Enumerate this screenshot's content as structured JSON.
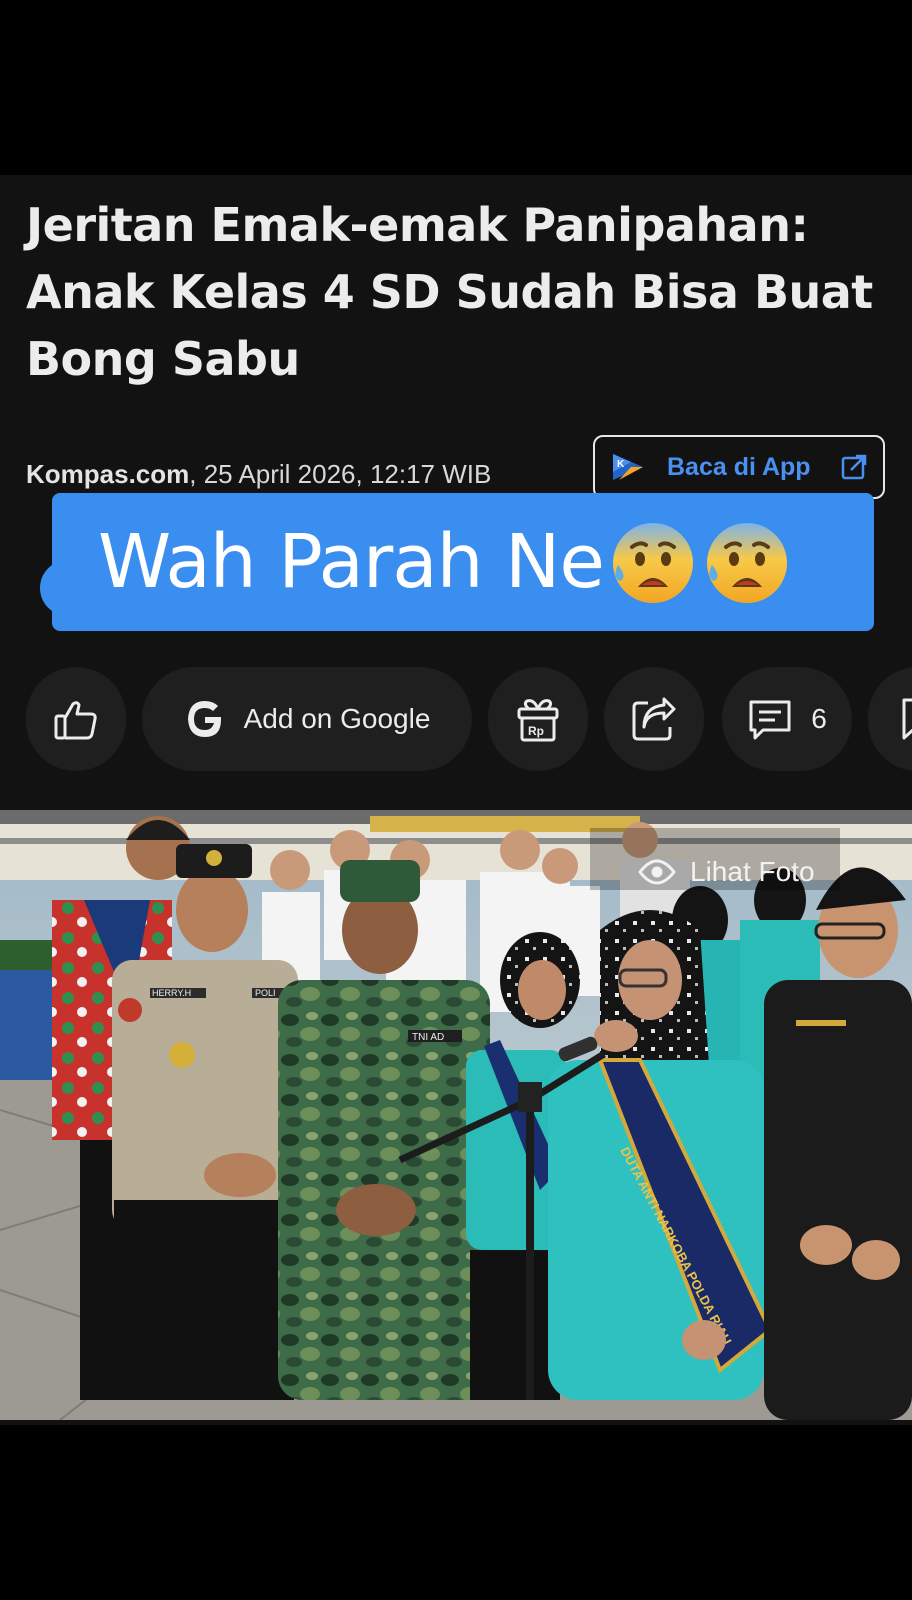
{
  "article": {
    "headline": "Jeritan Emak-emak Panipahan: Anak Kelas 4 SD Sudah Bisa Buat Bong Sabu",
    "source": "Kompas.com",
    "datetime": ", 25 April 2026, 12:17 WIB",
    "app_button_label": "Baca di App"
  },
  "overlay": {
    "text": "Wah Parah Ne",
    "emoji_count": 2,
    "color": "#3a8ef0"
  },
  "actions": {
    "like_icon": "thumbs-up-icon",
    "google_label": "Add on Google",
    "gift_badge": "Rp",
    "share_icon": "share-icon",
    "comment_count": "6",
    "bookmark_icon": "bookmark-icon"
  },
  "photo": {
    "view_label": "Lihat Foto",
    "badge_names": [
      "HERRY.H",
      "TNI AD",
      "POLI"
    ],
    "sash_text": "DUTA ANTI NARKOBA POLDA RIAU"
  },
  "colors": {
    "background": "#000000",
    "card": "#121212",
    "accent": "#3a8ef0",
    "link": "#4a90f0"
  }
}
